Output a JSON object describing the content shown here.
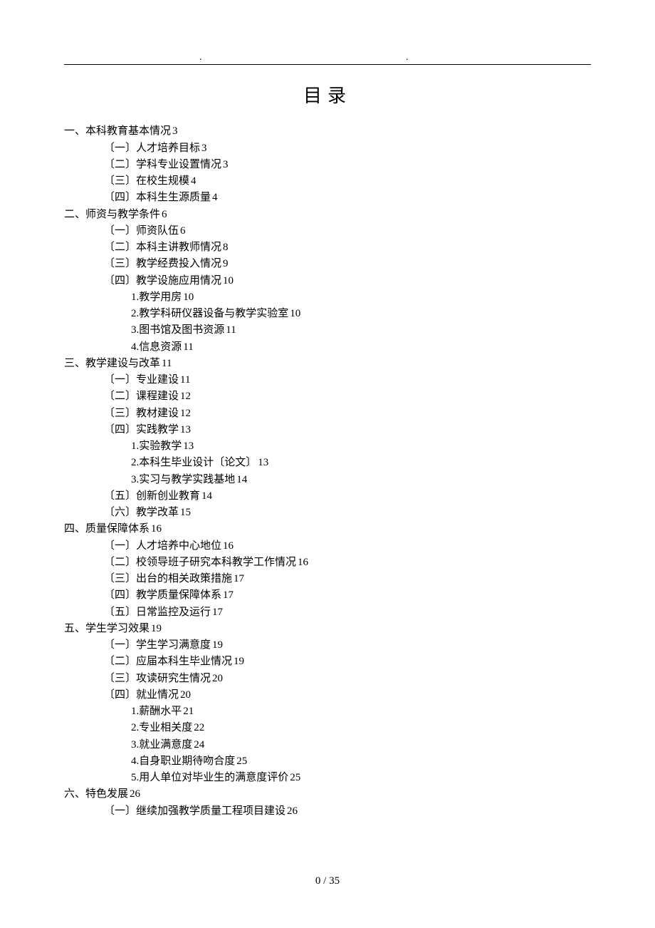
{
  "title": "目录",
  "footer": "0 / 35",
  "toc": [
    {
      "level": 1,
      "text": "一、本科教育基本情况",
      "page": "3"
    },
    {
      "level": 2,
      "text": "〔一〕人才培养目标",
      "page": "3"
    },
    {
      "level": 2,
      "text": "〔二〕学科专业设置情况",
      "page": "3"
    },
    {
      "level": 2,
      "text": "〔三〕在校生规模",
      "page": "4"
    },
    {
      "level": 2,
      "text": "〔四〕本科生生源质量",
      "page": "4"
    },
    {
      "level": 1,
      "text": "二、师资与教学条件",
      "page": "6"
    },
    {
      "level": 2,
      "text": "〔一〕师资队伍",
      "page": "6"
    },
    {
      "level": 2,
      "text": "〔二〕本科主讲教师情况",
      "page": "8"
    },
    {
      "level": 2,
      "text": "〔三〕教学经费投入情况",
      "page": "9"
    },
    {
      "level": 2,
      "text": "〔四〕教学设施应用情况",
      "page": "10"
    },
    {
      "level": 3,
      "text": "1.教学用房",
      "page": "10"
    },
    {
      "level": 3,
      "text": "2.教学科研仪器设备与教学实验室",
      "page": "10"
    },
    {
      "level": 3,
      "text": "3.图书馆及图书资源",
      "page": "11"
    },
    {
      "level": 3,
      "text": "4.信息资源",
      "page": "11"
    },
    {
      "level": 1,
      "text": "三、教学建设与改革",
      "page": "11"
    },
    {
      "level": 2,
      "text": "〔一〕专业建设",
      "page": "11"
    },
    {
      "level": 2,
      "text": "〔二〕课程建设",
      "page": "12"
    },
    {
      "level": 2,
      "text": "〔三〕教材建设",
      "page": "12"
    },
    {
      "level": 2,
      "text": "〔四〕实践教学",
      "page": "13"
    },
    {
      "level": 3,
      "text": "1.实验教学",
      "page": "13"
    },
    {
      "level": 3,
      "text": "2.本科生毕业设计〔论文〕",
      "page": "13"
    },
    {
      "level": 3,
      "text": "3.实习与教学实践基地",
      "page": "14"
    },
    {
      "level": 2,
      "text": "〔五〕创新创业教育",
      "page": "14"
    },
    {
      "level": 2,
      "text": "〔六〕教学改革",
      "page": "15"
    },
    {
      "level": 1,
      "text": "四、质量保障体系",
      "page": "16"
    },
    {
      "level": 2,
      "text": "〔一〕人才培养中心地位",
      "page": "16"
    },
    {
      "level": 2,
      "text": "〔二〕校领导班子研究本科教学工作情况",
      "page": "16"
    },
    {
      "level": 2,
      "text": "〔三〕出台的相关政策措施",
      "page": "17"
    },
    {
      "level": 2,
      "text": "〔四〕教学质量保障体系",
      "page": "17"
    },
    {
      "level": 2,
      "text": "〔五〕日常监控及运行",
      "page": "17"
    },
    {
      "level": 1,
      "text": "五、学生学习效果",
      "page": "19"
    },
    {
      "level": 2,
      "text": "〔一〕学生学习满意度",
      "page": "19"
    },
    {
      "level": 2,
      "text": "〔二〕应届本科生毕业情况",
      "page": "19"
    },
    {
      "level": 2,
      "text": "〔三〕攻读研究生情况",
      "page": "20"
    },
    {
      "level": 2,
      "text": "〔四〕就业情况",
      "page": "20"
    },
    {
      "level": 3,
      "text": "1.薪酬水平",
      "page": "21"
    },
    {
      "level": 3,
      "text": "2.专业相关度",
      "page": "22"
    },
    {
      "level": 3,
      "text": "3.就业满意度",
      "page": "24"
    },
    {
      "level": 3,
      "text": "4.自身职业期待吻合度",
      "page": "25"
    },
    {
      "level": 3,
      "text": "5.用人单位对毕业生的满意度评价",
      "page": "25"
    },
    {
      "level": 1,
      "text": "六、特色发展",
      "page": "26"
    },
    {
      "level": 2,
      "text": "〔一〕继续加强教学质量工程项目建设",
      "page": "26"
    }
  ]
}
